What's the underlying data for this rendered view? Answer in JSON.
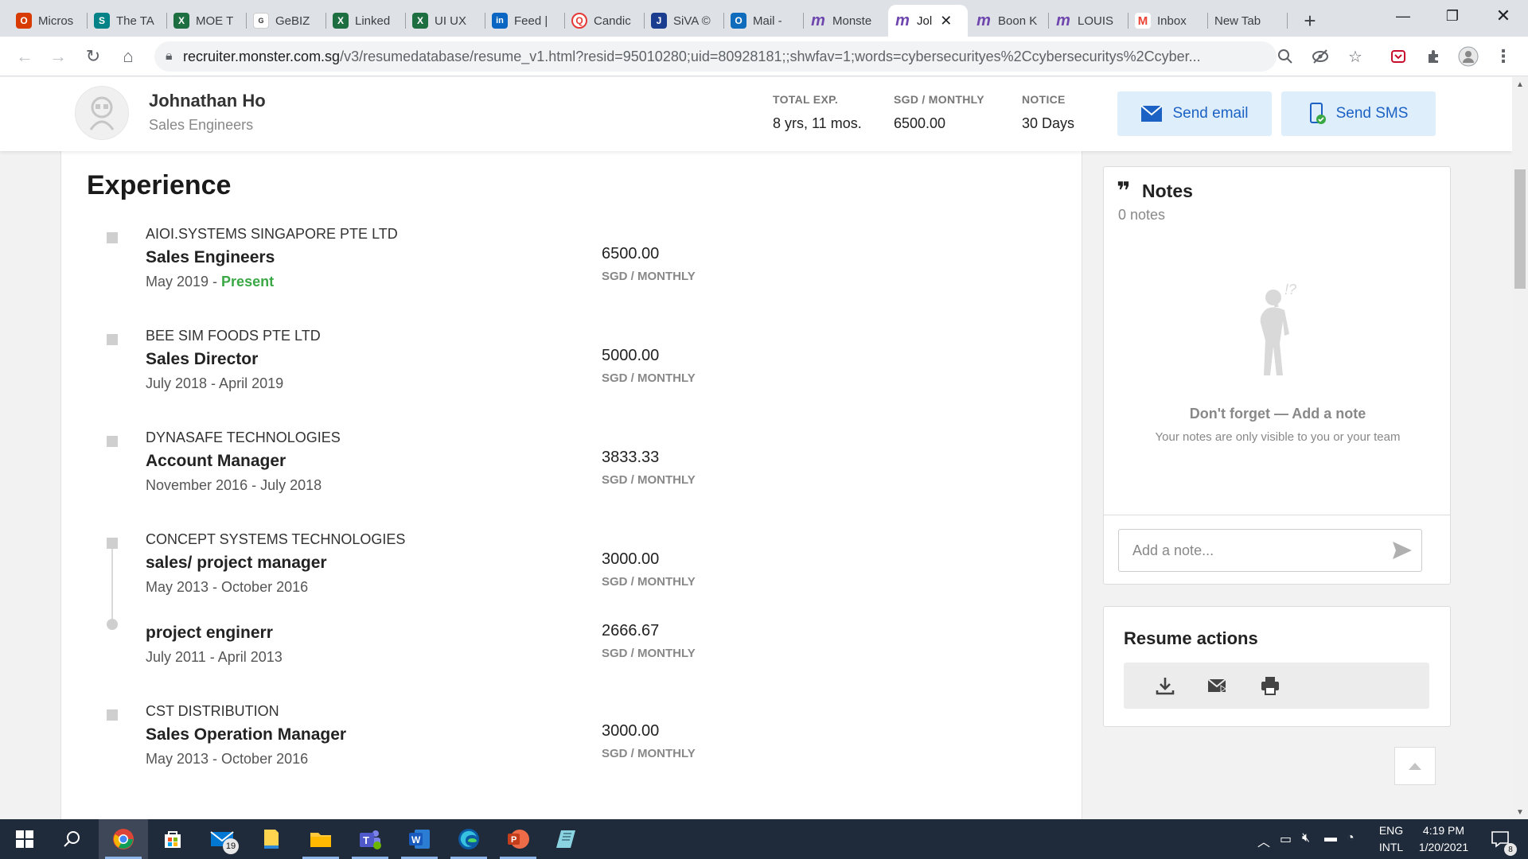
{
  "browser": {
    "tabs": [
      {
        "title": "Micros",
        "icon": "office-icon",
        "color": "#d83b01",
        "glyph": "O"
      },
      {
        "title": "The TA",
        "icon": "sharepoint-icon",
        "color": "#038387",
        "glyph": "S"
      },
      {
        "title": "MOE T",
        "icon": "excel-icon",
        "color": "#1d6f42",
        "glyph": "X"
      },
      {
        "title": "GeBIZ",
        "icon": "gebiz-icon",
        "color": "#ffffff",
        "glyph": "G"
      },
      {
        "title": "Linked",
        "icon": "excel-icon",
        "color": "#1d6f42",
        "glyph": "X"
      },
      {
        "title": "UI UX",
        "icon": "excel-icon",
        "color": "#1d6f42",
        "glyph": "X"
      },
      {
        "title": "Feed |",
        "icon": "linkedin-icon",
        "color": "#0a66c2",
        "glyph": "in"
      },
      {
        "title": "Candic",
        "icon": "candidate-icon",
        "color": "#e53935",
        "glyph": "Q"
      },
      {
        "title": "SiVA ©",
        "icon": "siva-icon",
        "color": "#1a3d8f",
        "glyph": "J"
      },
      {
        "title": "Mail -",
        "icon": "outlook-icon",
        "color": "#0f6cbd",
        "glyph": "O"
      },
      {
        "title": "Monste",
        "icon": "monster-icon",
        "color": "#6e46ae",
        "glyph": "m"
      },
      {
        "title": "Jol",
        "icon": "monster-icon",
        "color": "#6e46ae",
        "glyph": "m",
        "active": true
      },
      {
        "title": "Boon K",
        "icon": "monster-icon",
        "color": "#6e46ae",
        "glyph": "m"
      },
      {
        "title": "LOUIS",
        "icon": "monster-icon",
        "color": "#6e46ae",
        "glyph": "m"
      },
      {
        "title": "Inbox",
        "icon": "gmail-icon",
        "color": "#ea4335",
        "glyph": "M"
      },
      {
        "title": "New Tab",
        "icon": "",
        "color": "",
        "glyph": ""
      }
    ],
    "url_host": "recruiter.monster.com.sg",
    "url_path": "/v3/resumedatabase/resume_v1.html?resid=95010280;uid=80928181;;shwfav=1;words=cybersecurityes%2Ccybersecuritys%2Ccyber..."
  },
  "profile": {
    "name": "Johnathan Ho",
    "title": "Sales Engineers",
    "total_exp_label": "TOTAL EXP.",
    "total_exp_value": "8 yrs, 11 mos.",
    "salary_label": "SGD / MONTHLY",
    "salary_value": "6500.00",
    "notice_label": "NOTICE",
    "notice_value": "30 Days",
    "send_email_label": "Send email",
    "send_sms_label": "Send SMS"
  },
  "experience": {
    "title": "Experience",
    "items": [
      {
        "company": "AIOI.SYSTEMS SINGAPORE PTE LTD",
        "role": "Sales Engineers",
        "start": "May 2019 - ",
        "end": "Present",
        "salary": "6500.00",
        "unit": "SGD / MONTHLY"
      },
      {
        "company": "BEE SIM FOODS PTE LTD",
        "role": "Sales Director",
        "dates": "July 2018 - April 2019",
        "salary": "5000.00",
        "unit": "SGD / MONTHLY"
      },
      {
        "company": "DYNASAFE TECHNOLOGIES",
        "role": "Account Manager",
        "dates": "November 2016 - July 2018",
        "salary": "3833.33",
        "unit": "SGD / MONTHLY"
      },
      {
        "company": "CONCEPT SYSTEMS TECHNOLOGIES",
        "role": "sales/ project manager",
        "dates": "May 2013 - October 2016",
        "salary": "3000.00",
        "unit": "SGD / MONTHLY"
      },
      {
        "role": "project enginerr",
        "dates": "July 2011 - April 2013",
        "salary": "2666.67",
        "unit": "SGD / MONTHLY"
      },
      {
        "company": "CST DISTRIBUTION",
        "role": "Sales Operation Manager",
        "dates": "May 2013 - October 2016",
        "salary": "3000.00",
        "unit": "SGD / MONTHLY"
      }
    ]
  },
  "notes": {
    "title": "Notes",
    "count": "0 notes",
    "empty_title": "Don't forget — Add a note",
    "empty_sub": "Your notes are only visible to you or your team",
    "input_placeholder": "Add a note..."
  },
  "resume_actions": {
    "title": "Resume actions"
  },
  "taskbar": {
    "mail_badge": "19",
    "lang_top": "ENG",
    "lang_bottom": "INTL",
    "time": "4:19 PM",
    "date": "1/20/2021",
    "notif_count": "8"
  },
  "colors": {
    "accent_blue": "#1b62c4",
    "present_green": "#3aa845",
    "button_bg": "#dfeefb"
  }
}
